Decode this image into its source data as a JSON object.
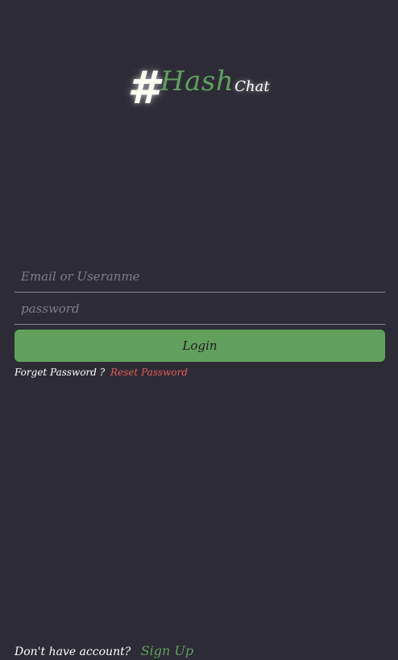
{
  "logo": {
    "symbol": "#",
    "main": "Hash",
    "sub": "Chat"
  },
  "form": {
    "email_placeholder": "Email or Useranme",
    "password_placeholder": "password",
    "login_label": "Login"
  },
  "forget": {
    "text": "Forget Password ?",
    "link": "Reset Password"
  },
  "signup": {
    "text": "Don't have account?",
    "link": "Sign Up"
  },
  "colors": {
    "background": "#2d2b35",
    "accent": "#62a05e",
    "link_red": "#e25b5b"
  }
}
